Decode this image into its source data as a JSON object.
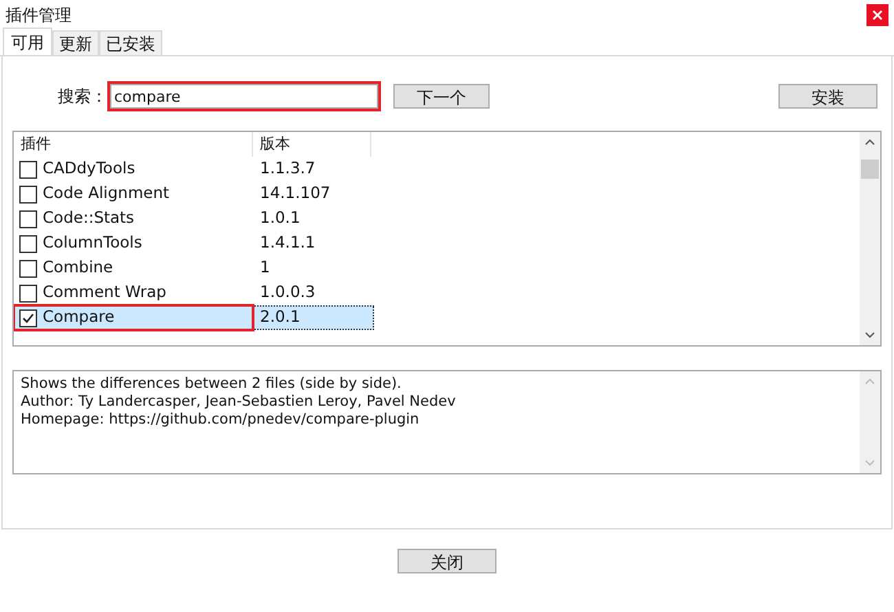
{
  "window": {
    "title": "插件管理"
  },
  "tabs": [
    {
      "label": "可用",
      "selected": true
    },
    {
      "label": "更新",
      "selected": false
    },
    {
      "label": "已安装",
      "selected": false
    }
  ],
  "search": {
    "label": "搜索：",
    "value": "compare",
    "highlighted": true
  },
  "next_button": "下一个",
  "install_button": "安装",
  "table": {
    "columns": [
      "插件",
      "版本"
    ],
    "rows": [
      {
        "name": "CADdyTools",
        "version": "1.1.3.7",
        "checked": false,
        "selected": false,
        "highlighted": false
      },
      {
        "name": "Code Alignment",
        "version": "14.1.107",
        "checked": false,
        "selected": false,
        "highlighted": false
      },
      {
        "name": "Code::Stats",
        "version": "1.0.1",
        "checked": false,
        "selected": false,
        "highlighted": false
      },
      {
        "name": "ColumnTools",
        "version": "1.4.1.1",
        "checked": false,
        "selected": false,
        "highlighted": false
      },
      {
        "name": "Combine",
        "version": "1",
        "checked": false,
        "selected": false,
        "highlighted": false
      },
      {
        "name": "Comment Wrap",
        "version": "1.0.0.3",
        "checked": false,
        "selected": false,
        "highlighted": false
      },
      {
        "name": "Compare",
        "version": "2.0.1",
        "checked": true,
        "selected": true,
        "highlighted": true
      }
    ]
  },
  "description": [
    "Shows the differences between 2 files (side by side).",
    "Author: Ty Landercasper, Jean-Sebastien Leroy, Pavel Nedev",
    "Homepage: https://github.com/pnedev/compare-plugin"
  ],
  "close_button": "关闭"
}
